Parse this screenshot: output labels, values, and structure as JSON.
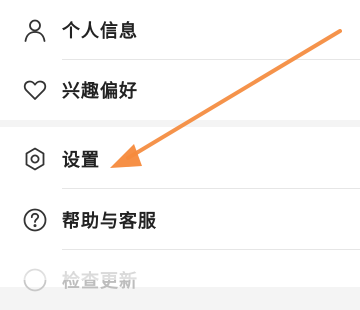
{
  "menu": {
    "items": [
      {
        "label": "个人信息",
        "icon": "person-icon"
      },
      {
        "label": "兴趣偏好",
        "icon": "heart-icon"
      },
      {
        "label": "设置",
        "icon": "gear-icon"
      },
      {
        "label": "帮助与客服",
        "icon": "help-circle-icon"
      },
      {
        "label": "检查更新",
        "icon": "update-icon"
      }
    ]
  },
  "annotation": {
    "color": "#f58a3c",
    "points_to": "设置"
  }
}
